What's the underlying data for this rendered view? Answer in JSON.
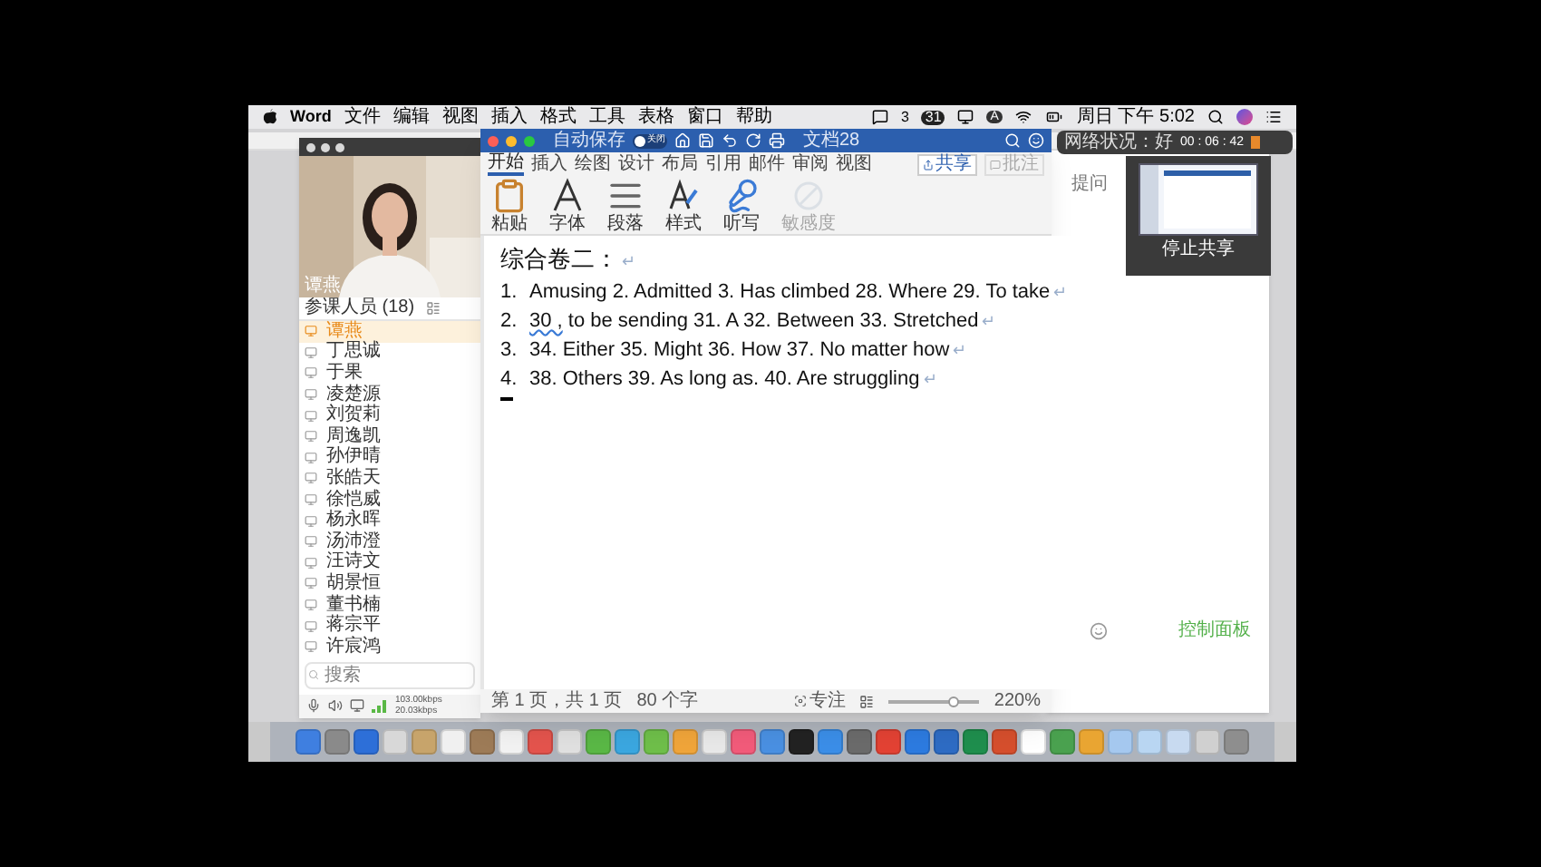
{
  "menu_bar": {
    "app": "Word",
    "items": [
      "文件",
      "编辑",
      "视图",
      "插入",
      "格式",
      "工具",
      "表格",
      "窗口",
      "帮助"
    ],
    "wechat_count": "3",
    "badge_count": "31",
    "input_label": "A",
    "clock": "周日 下午 5:02"
  },
  "meeting": {
    "video_name": "谭燕",
    "participants_title": "参课人员 (18)",
    "participants": [
      {
        "name": "谭燕",
        "selected": true
      },
      {
        "name": "丁思诚",
        "selected": false
      },
      {
        "name": "于果",
        "selected": false
      },
      {
        "name": "凌楚源",
        "selected": false
      },
      {
        "name": "刘贺莉",
        "selected": false
      },
      {
        "name": "周逸凯",
        "selected": false
      },
      {
        "name": "孙伊晴",
        "selected": false
      },
      {
        "name": "张皓天",
        "selected": false
      },
      {
        "name": "徐恺威",
        "selected": false
      },
      {
        "name": "杨永晖",
        "selected": false
      },
      {
        "name": "汤沛澄",
        "selected": false
      },
      {
        "name": "汪诗文",
        "selected": false
      },
      {
        "name": "胡景恒",
        "selected": false
      },
      {
        "name": "董书楠",
        "selected": false
      },
      {
        "name": "蒋宗平",
        "selected": false
      },
      {
        "name": "许宸鸿",
        "selected": false
      }
    ],
    "search_placeholder": "搜索",
    "upload": "103.00kbps",
    "download": "20.03kbps"
  },
  "word": {
    "autosave": "自动保存",
    "autosave_state": "关闭",
    "autosave_on": false,
    "title": "文档28",
    "tabs": [
      {
        "label": "开始",
        "selected": true
      },
      {
        "label": "插入",
        "selected": false
      },
      {
        "label": "绘图",
        "selected": false
      },
      {
        "label": "设计",
        "selected": false
      },
      {
        "label": "布局",
        "selected": false
      },
      {
        "label": "引用",
        "selected": false
      },
      {
        "label": "邮件",
        "selected": false
      },
      {
        "label": "审阅",
        "selected": false
      },
      {
        "label": "视图",
        "selected": false
      }
    ],
    "share": "共享",
    "comment": "批注",
    "ribbon": [
      {
        "kind": "paste",
        "label": "粘贴",
        "disabled": false
      },
      {
        "kind": "font",
        "label": "字体",
        "disabled": false
      },
      {
        "kind": "paragraph",
        "label": "段落",
        "disabled": false
      },
      {
        "kind": "styles",
        "label": "样式",
        "disabled": false
      },
      {
        "kind": "dictate",
        "label": "听写",
        "disabled": false
      },
      {
        "kind": "sensitivity",
        "label": "敏感度",
        "disabled": true
      }
    ],
    "heading": "综合卷二：",
    "heading_mark": "↵",
    "lines": [
      {
        "number": "1.",
        "segments": [
          {
            "text": "Amusing 2. Admitted 3. Has climbed 28. Where 29. To take",
            "flagged": false
          }
        ],
        "mark": "↵"
      },
      {
        "number": "2.",
        "segments": [
          {
            "text": "30 ,",
            "flagged": true
          },
          {
            "text": " to be sending 31. A 32. Between 33. Stretched",
            "flagged": false
          }
        ],
        "mark": "↵"
      },
      {
        "number": "3.",
        "segments": [
          {
            "text": "34. Either 35. Might 36. How 37. No matter how",
            "flagged": false
          }
        ],
        "mark": "↵"
      },
      {
        "number": "4.",
        "segments": [
          {
            "text": "38. Others 39. As long as. 40. Are struggling",
            "flagged": false
          }
        ],
        "mark": "↵"
      }
    ],
    "status": {
      "page": "第 1 页，共 1 页",
      "words": "80 个字",
      "focus": "专注",
      "zoom": "220%",
      "level": 0.72
    }
  },
  "side": {
    "network": "网络状况：好",
    "timer": "00 : 06 : 42",
    "tab": "提问",
    "stop_share": "停止共享",
    "control_panel": "控制面板"
  }
}
